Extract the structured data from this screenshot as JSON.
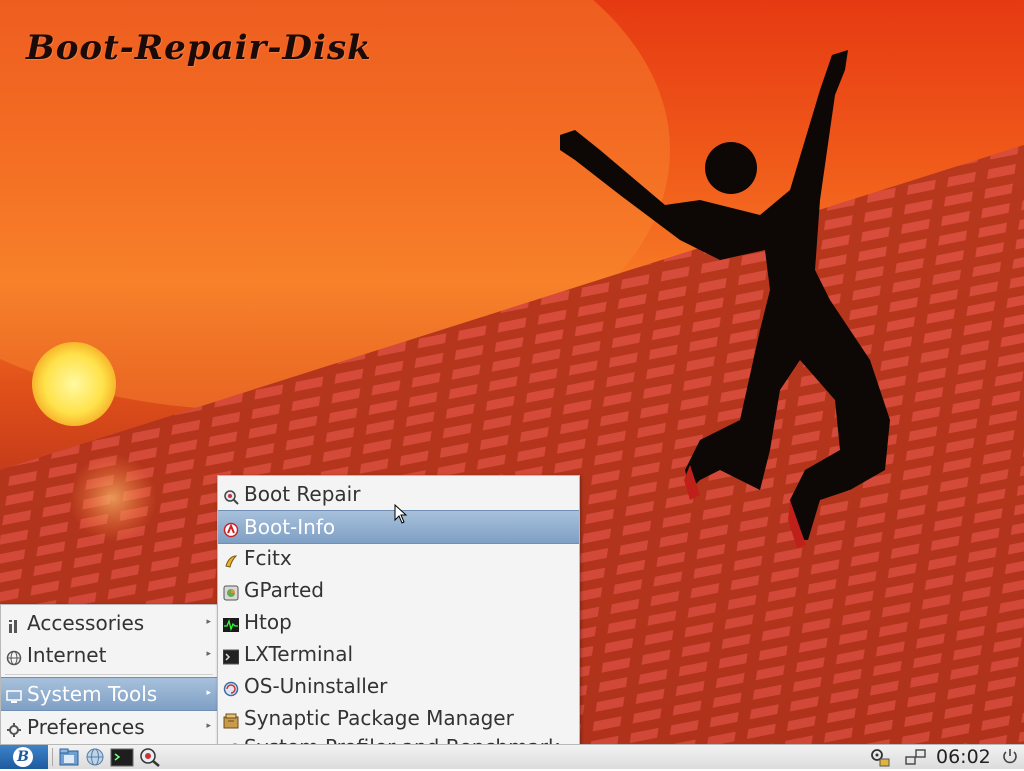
{
  "wallpaper": {
    "title": "Boot-Repair-Disk"
  },
  "main_menu": {
    "items": [
      {
        "label": "Accessories",
        "icon": "accessories-icon"
      },
      {
        "label": "Internet",
        "icon": "globe-icon"
      },
      {
        "label": "System Tools",
        "icon": "monitor-icon",
        "selected": true
      },
      {
        "label": "Preferences",
        "icon": "gear-icon"
      }
    ]
  },
  "system_tools_menu": {
    "items": [
      {
        "label": "Boot Repair",
        "icon": "boot-repair-icon"
      },
      {
        "label": "Boot-Info",
        "icon": "boot-info-icon",
        "hovered": true
      },
      {
        "label": "Fcitx",
        "icon": "fcitx-icon"
      },
      {
        "label": "GParted",
        "icon": "gparted-icon"
      },
      {
        "label": "Htop",
        "icon": "htop-icon"
      },
      {
        "label": "LXTerminal",
        "icon": "terminal-icon"
      },
      {
        "label": "OS-Uninstaller",
        "icon": "os-uninstaller-icon"
      },
      {
        "label": "Synaptic Package Manager",
        "icon": "synaptic-icon"
      },
      {
        "label": "System Profiler and Benchmark",
        "icon": "profiler-icon"
      }
    ]
  },
  "taskbar": {
    "start_logo": "B",
    "launchers": [
      "file-manager-icon",
      "web-browser-icon",
      "terminal-icon",
      "boot-repair-icon"
    ],
    "tray": [
      "update-icon",
      "network-icon",
      "power-icon"
    ],
    "clock": "06:02"
  },
  "colors": {
    "menu_bg": "#f4f4f4",
    "selection": "#8eaed0",
    "taskbar": "#e6e6e6",
    "start_button": "#2a6ab3"
  }
}
